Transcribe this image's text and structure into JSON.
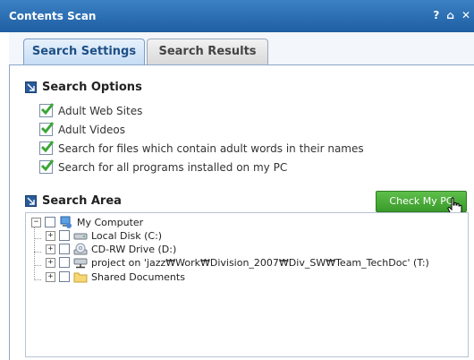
{
  "window": {
    "title": "Contents Scan",
    "icons": [
      "?",
      "⌂",
      "✕"
    ]
  },
  "tabs": [
    {
      "label": "Search Settings",
      "active": true
    },
    {
      "label": "Search Results",
      "active": false
    }
  ],
  "search_options": {
    "heading": "Search Options",
    "items": [
      {
        "label": "Adult Web Sites",
        "checked": true
      },
      {
        "label": "Adult Videos",
        "checked": true
      },
      {
        "label": "Search for files which contain adult words in their names",
        "checked": true
      },
      {
        "label": "Search for all programs installed on my PC",
        "checked": true
      }
    ]
  },
  "search_area": {
    "heading": "Search Area",
    "button_label": "Check My PC",
    "tree": {
      "root": "My Computer",
      "children": [
        "Local Disk (C:)",
        "CD-RW Drive (D:)",
        "project on 'jazz₩Work₩Division_2007₩Div_SW₩Team_TechDoc' (T:)",
        "Shared Documents"
      ]
    }
  },
  "colors": {
    "titlebar": "#2a6bb0",
    "accent_green": "#4aaa36",
    "check_green": "#3aa635"
  }
}
